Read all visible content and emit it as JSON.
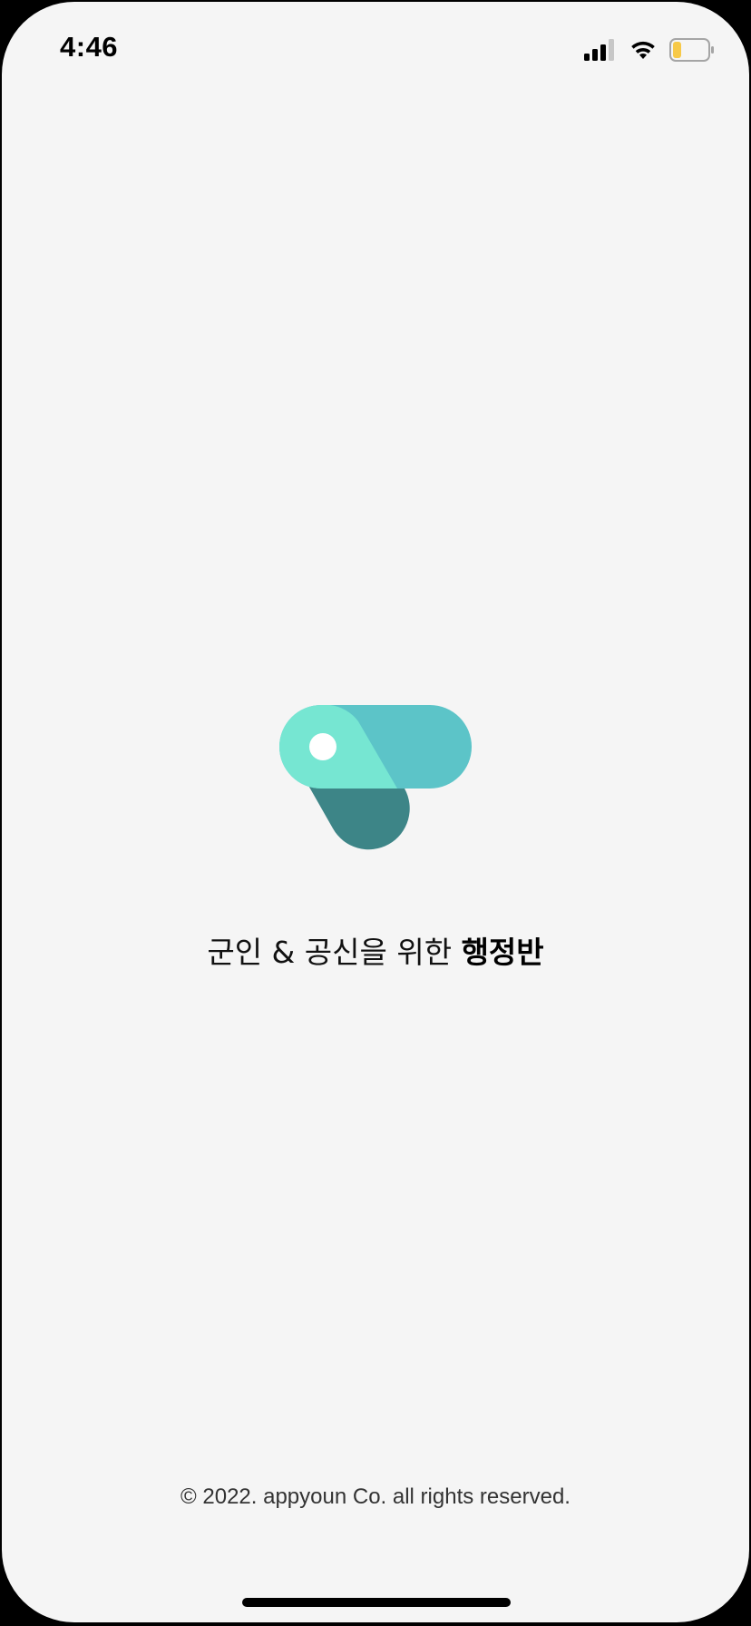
{
  "status_bar": {
    "time": "4:46",
    "icons": [
      "cellular-signal-icon",
      "wifi-icon",
      "battery-icon"
    ],
    "battery_level": 0.25,
    "battery_color": "#f7c948"
  },
  "splash": {
    "logo": "app-logo-icon",
    "logo_colors": {
      "light_mint": "#76e6d2",
      "teal": "#5cc4c8",
      "dark_teal": "#3d8587",
      "hole": "#ffffff"
    },
    "tagline_regular": "군인 & 공신을 위한 ",
    "tagline_bold": "행정반"
  },
  "footer": {
    "copyright": "© 2022. appyoun Co. all rights reserved."
  },
  "colors": {
    "background": "#f5f5f5",
    "frame": "#000000",
    "text": "#111111"
  }
}
